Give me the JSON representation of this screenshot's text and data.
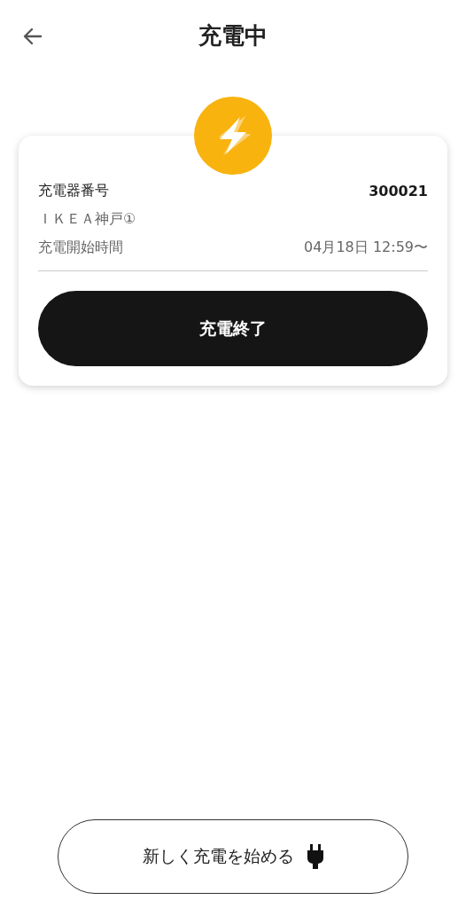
{
  "header": {
    "title": "充電中"
  },
  "session": {
    "charger_label": "充電器番号",
    "charger_number": "300021",
    "station": "ＩＫＥＡ神戸①",
    "start_label": "充電開始時間",
    "start_time": "04月18日 12:59〜",
    "stop_button": "充電終了"
  },
  "footer": {
    "new_button": "新しく充電を始める"
  }
}
